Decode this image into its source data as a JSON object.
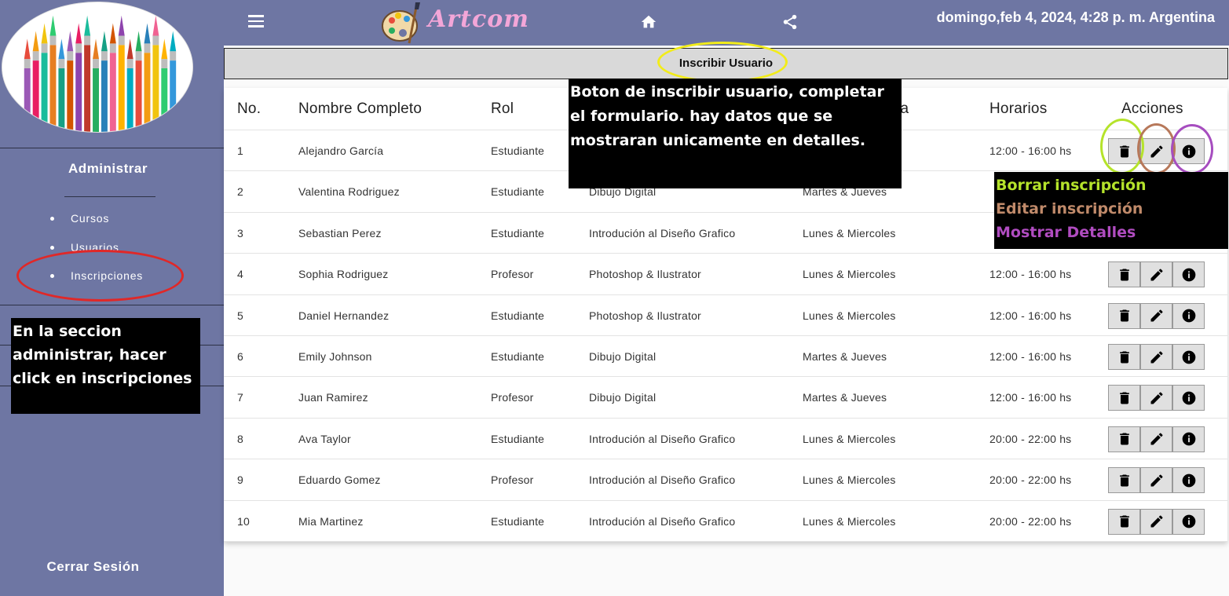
{
  "sidebar": {
    "section_title": "Administrar",
    "items": [
      {
        "label": "Cursos"
      },
      {
        "label": "Usuarios"
      },
      {
        "label": "Inscripciones"
      }
    ],
    "logout_label": "Cerrar Sesión"
  },
  "header": {
    "brand": "Artcom",
    "datetime": "domingo,feb 4, 2024, 4:28 p. m. Argentina",
    "menu_icon": "menu-icon",
    "home_icon": "home-icon",
    "share_icon": "share-icon"
  },
  "enroll_button_label": "Inscribir Usuario",
  "table": {
    "headers": {
      "no": "No.",
      "name": "Nombre Completo",
      "rol": "Rol",
      "course": "",
      "days": "ada",
      "hours": "Horarios",
      "actions": "Acciones"
    },
    "rows": [
      {
        "no": "1",
        "name": "Alejandro García",
        "rol": "Estudiante",
        "course": "",
        "days": "",
        "hours": "12:00 - 16:00 hs"
      },
      {
        "no": "2",
        "name": "Valentina Rodriguez",
        "rol": "Estudiante",
        "course": "Dibujo Digital",
        "days": "Martes & Jueves",
        "hours": ""
      },
      {
        "no": "3",
        "name": "Sebastian Perez",
        "rol": "Estudiante",
        "course": "Introdución al Diseño Grafico",
        "days": "Lunes & Miercoles",
        "hours": ""
      },
      {
        "no": "4",
        "name": "Sophia Rodriguez",
        "rol": "Profesor",
        "course": "Photoshop & Ilustrator",
        "days": "Lunes & Miercoles",
        "hours": "12:00 - 16:00 hs"
      },
      {
        "no": "5",
        "name": "Daniel Hernandez",
        "rol": "Estudiante",
        "course": "Photoshop & Ilustrator",
        "days": "Lunes & Miercoles",
        "hours": "12:00 - 16:00 hs"
      },
      {
        "no": "6",
        "name": "Emily Johnson",
        "rol": "Estudiante",
        "course": "Dibujo Digital",
        "days": "Martes & Jueves",
        "hours": "12:00 - 16:00 hs"
      },
      {
        "no": "7",
        "name": "Juan Ramirez",
        "rol": "Profesor",
        "course": "Dibujo Digital",
        "days": "Martes & Jueves",
        "hours": "12:00 - 16:00 hs"
      },
      {
        "no": "8",
        "name": "Ava Taylor",
        "rol": "Estudiante",
        "course": "Introdución al Diseño Grafico",
        "days": "Lunes & Miercoles",
        "hours": "20:00 - 22:00 hs"
      },
      {
        "no": "9",
        "name": "Eduardo Gomez",
        "rol": "Profesor",
        "course": "Introdución al Diseño Grafico",
        "days": "Lunes & Miercoles",
        "hours": "20:00 - 22:00 hs"
      },
      {
        "no": "10",
        "name": "Mia Martinez",
        "rol": "Estudiante",
        "course": "Introdución al Diseño Grafico",
        "days": "Lunes & Miercoles",
        "hours": "20:00 - 22:00 hs"
      }
    ],
    "action_icons": [
      "trash-icon",
      "pencil-icon",
      "info-icon"
    ]
  },
  "annotations": {
    "enroll_note": "Boton de inscribir usuario, completar el formulario. hay datos que se mostraran unicamente en detalles.",
    "actions_note": {
      "delete": "Borrar inscripción",
      "edit": "Editar inscripción",
      "details": "Mostrar Detalles"
    },
    "sidebar_note": "En la seccion administrar, hacer click en inscripciones"
  },
  "colors": {
    "sidebar_bg": "#6e76a3",
    "header_bg": "#6e76a3",
    "brand": "#f3a6d8",
    "ring_yellow": "#f2ec1a",
    "ring_red": "#e02828",
    "ring_green": "#b5e32b",
    "ring_brown": "#b7785a",
    "ring_purple": "#a64dbf",
    "note_delete": "#b5e32b",
    "note_edit": "#c08a6a",
    "note_details": "#b04cc0"
  }
}
